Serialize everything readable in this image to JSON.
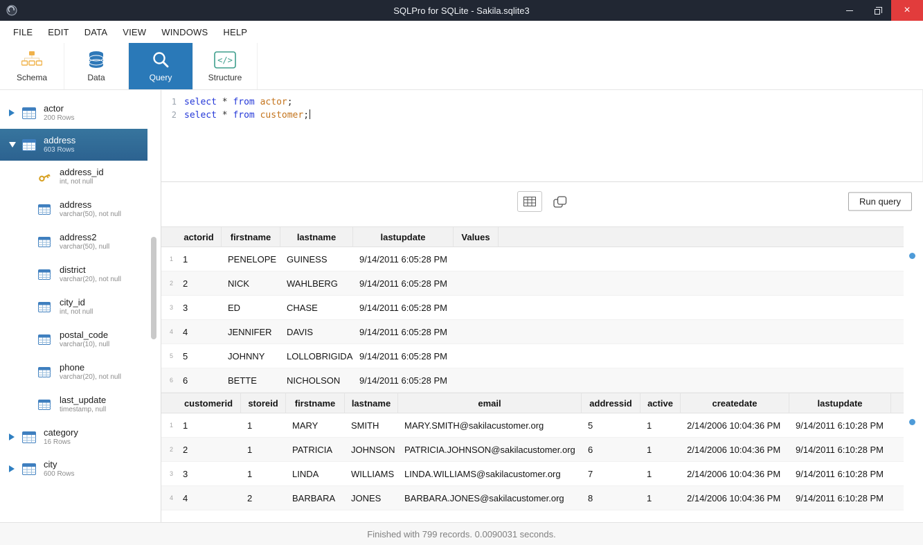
{
  "titlebar": {
    "title": "SQLPro for SQLite - Sakila.sqlite3",
    "close_glyph": "×",
    "icons": [
      "app-logo-icon",
      "minimize-icon",
      "restore-icon",
      "close-icon"
    ]
  },
  "menu": {
    "items": [
      "FILE",
      "EDIT",
      "DATA",
      "VIEW",
      "WINDOWS",
      "HELP"
    ]
  },
  "toolbar": {
    "active_color": "#2a79b8",
    "tabs": [
      {
        "label": "Schema",
        "icon": "schema-icon",
        "active": false
      },
      {
        "label": "Data",
        "icon": "database-icon",
        "active": false
      },
      {
        "label": "Query",
        "icon": "magnifier-icon",
        "active": true
      },
      {
        "label": "Structure",
        "icon": "code-icon",
        "active": false
      }
    ]
  },
  "sidebar": {
    "tables": [
      {
        "name": "actor",
        "rows": "200 Rows",
        "expanded": false,
        "selected": false,
        "columns": []
      },
      {
        "name": "address",
        "rows": "603 Rows",
        "expanded": true,
        "selected": true,
        "columns": [
          {
            "name": "address_id",
            "type": "int, not null",
            "icon": "key-icon"
          },
          {
            "name": "address",
            "type": "varchar(50), not null",
            "icon": "column-icon"
          },
          {
            "name": "address2",
            "type": "varchar(50), null",
            "icon": "column-icon"
          },
          {
            "name": "district",
            "type": "varchar(20), not null",
            "icon": "column-icon"
          },
          {
            "name": "city_id",
            "type": "int, not null",
            "icon": "column-icon"
          },
          {
            "name": "postal_code",
            "type": "varchar(10), null",
            "icon": "column-icon"
          },
          {
            "name": "phone",
            "type": "varchar(20), not null",
            "icon": "column-icon"
          },
          {
            "name": "last_update",
            "type": "timestamp, null",
            "icon": "column-icon"
          }
        ]
      },
      {
        "name": "category",
        "rows": "16 Rows",
        "expanded": false,
        "selected": false,
        "columns": []
      },
      {
        "name": "city",
        "rows": "600 Rows",
        "expanded": false,
        "selected": false,
        "columns": []
      }
    ]
  },
  "editor": {
    "colors": {
      "keyword": "#2438d8",
      "entity": "#c4741d",
      "plain": "#333333"
    },
    "lines": [
      {
        "number": "1",
        "caret": false,
        "tokens": [
          {
            "text": "select",
            "type": "keyword"
          },
          {
            "text": " * ",
            "type": "plain"
          },
          {
            "text": "from",
            "type": "keyword"
          },
          {
            "text": " ",
            "type": "plain"
          },
          {
            "text": "actor",
            "type": "entity"
          },
          {
            "text": ";",
            "type": "plain"
          }
        ]
      },
      {
        "number": "2",
        "caret": true,
        "tokens": [
          {
            "text": "select",
            "type": "keyword"
          },
          {
            "text": " * ",
            "type": "plain"
          },
          {
            "text": "from",
            "type": "keyword"
          },
          {
            "text": " ",
            "type": "plain"
          },
          {
            "text": "customer",
            "type": "entity"
          },
          {
            "text": ";",
            "type": "plain"
          }
        ]
      }
    ]
  },
  "results_toolbar": {
    "run_label": "Run query",
    "icons": [
      "table-view-icon",
      "copy-icon"
    ]
  },
  "results": {
    "tables": [
      {
        "columns": [
          "actorid",
          "firstname",
          "lastname",
          "lastupdate",
          "Values"
        ],
        "rows": [
          [
            "1",
            "PENELOPE",
            "GUINESS",
            "9/14/2011 6:05:28 PM",
            ""
          ],
          [
            "2",
            "NICK",
            "WAHLBERG",
            "9/14/2011 6:05:28 PM",
            ""
          ],
          [
            "3",
            "ED",
            "CHASE",
            "9/14/2011 6:05:28 PM",
            ""
          ],
          [
            "4",
            "JENNIFER",
            "DAVIS",
            "9/14/2011 6:05:28 PM",
            ""
          ],
          [
            "5",
            "JOHNNY",
            "LOLLOBRIGIDA",
            "9/14/2011 6:05:28 PM",
            ""
          ],
          [
            "6",
            "BETTE",
            "NICHOLSON",
            "9/14/2011 6:05:28 PM",
            ""
          ]
        ]
      },
      {
        "columns": [
          "customerid",
          "storeid",
          "firstname",
          "lastname",
          "email",
          "addressid",
          "active",
          "createdate",
          "lastupdate"
        ],
        "rows": [
          [
            "1",
            "1",
            "MARY",
            "SMITH",
            "MARY.SMITH@sakilacustomer.org",
            "5",
            "1",
            "2/14/2006 10:04:36 PM",
            "9/14/2011 6:10:28 PM"
          ],
          [
            "2",
            "1",
            "PATRICIA",
            "JOHNSON",
            "PATRICIA.JOHNSON@sakilacustomer.org",
            "6",
            "1",
            "2/14/2006 10:04:36 PM",
            "9/14/2011 6:10:28 PM"
          ],
          [
            "3",
            "1",
            "LINDA",
            "WILLIAMS",
            "LINDA.WILLIAMS@sakilacustomer.org",
            "7",
            "1",
            "2/14/2006 10:04:36 PM",
            "9/14/2011 6:10:28 PM"
          ],
          [
            "4",
            "2",
            "BARBARA",
            "JONES",
            "BARBARA.JONES@sakilacustomer.org",
            "8",
            "1",
            "2/14/2006 10:04:36 PM",
            "9/14/2011 6:10:28 PM"
          ]
        ]
      }
    ]
  },
  "statusbar": {
    "text": "Finished with 799 records. 0.0090031 seconds."
  }
}
